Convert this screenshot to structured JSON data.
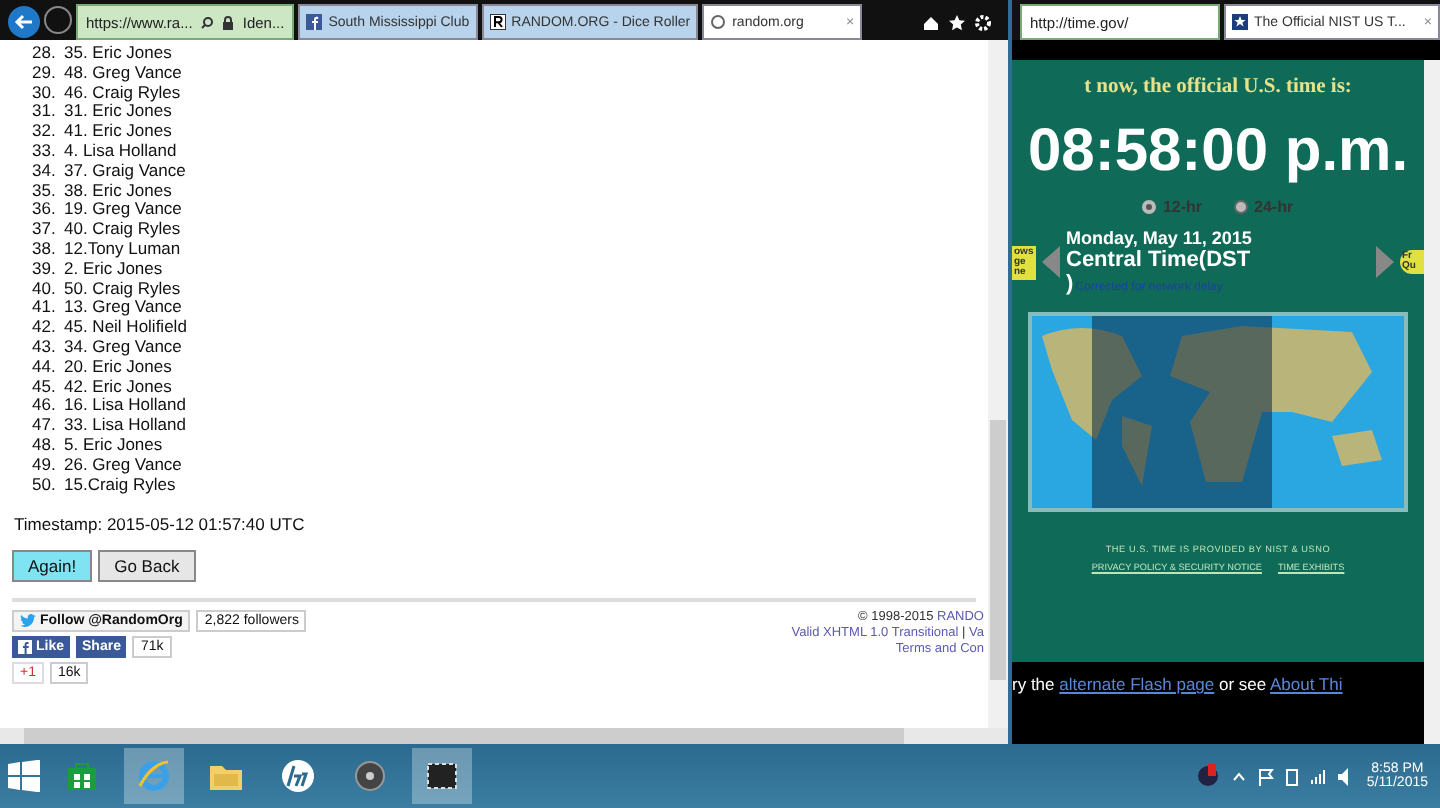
{
  "left_browser": {
    "address": "https://www.ra...",
    "identity": "Iden...",
    "tabs": [
      {
        "kind": "facebook",
        "label": "South Mississippi Club",
        "selected": false
      },
      {
        "kind": "random",
        "label": "RANDOM.ORG - Dice Roller",
        "selected": false
      },
      {
        "kind": "loading",
        "label": "random.org",
        "selected": true,
        "close": "×"
      }
    ],
    "results": [
      {
        "index": "28.",
        "value": "35. Eric Jones"
      },
      {
        "index": "29.",
        "value": "48. Greg Vance"
      },
      {
        "index": "30.",
        "value": "46. Craig Ryles"
      },
      {
        "index": "31.",
        "value": "31. Eric Jones"
      },
      {
        "index": "32.",
        "value": "41. Eric Jones"
      },
      {
        "index": "33.",
        "value": "4. Lisa Holland"
      },
      {
        "index": "34.",
        "value": "37. Graig Vance"
      },
      {
        "index": "35.",
        "value": "38. Eric Jones"
      },
      {
        "index": "36.",
        "value": "19. Greg Vance"
      },
      {
        "index": "37.",
        "value": "40. Craig Ryles"
      },
      {
        "index": "38.",
        "value": "12.Tony Luman"
      },
      {
        "index": "39.",
        "value": "2. Eric Jones"
      },
      {
        "index": "40.",
        "value": "50. Craig Ryles"
      },
      {
        "index": "41.",
        "value": "13. Greg Vance"
      },
      {
        "index": "42.",
        "value": "45. Neil Holifield"
      },
      {
        "index": "43.",
        "value": "34. Greg Vance"
      },
      {
        "index": "44.",
        "value": "20. Eric Jones"
      },
      {
        "index": "45.",
        "value": "42. Eric Jones"
      },
      {
        "index": "46.",
        "value": "16. Lisa Holland"
      },
      {
        "index": "47.",
        "value": "33. Lisa Holland"
      },
      {
        "index": "48.",
        "value": "5. Eric Jones"
      },
      {
        "index": "49.",
        "value": "26. Greg Vance"
      },
      {
        "index": "50.",
        "value": "15.Craig Ryles"
      }
    ],
    "timestamp": "Timestamp: 2015-05-12 01:57:40 UTC",
    "buttons": [
      {
        "label": "Again!",
        "selected": true
      },
      {
        "label": "Go Back",
        "selected": false
      }
    ],
    "social": {
      "follow": "Follow @RandomOrg",
      "followers": "2,822 followers",
      "like": "Like",
      "share": "Share",
      "share_count": "71k",
      "plus": "+1",
      "plus_count": "16k"
    },
    "footer": {
      "copyright": "© 1998-2015",
      "copyright_link": "RANDO",
      "xhtml": "Valid XHTML 1.0 Transitional",
      "separator": "|",
      "va": "Va",
      "terms": "Terms and Con"
    }
  },
  "right_browser": {
    "address": "http://time.gov/",
    "tab": "The Official NIST US T...",
    "tab_close": "×",
    "heading": "t now, the official U.S. time is:",
    "time": "08:58:00 p.m.",
    "formats": [
      {
        "label": "12-hr",
        "selected": true
      },
      {
        "label": "24-hr",
        "selected": false
      }
    ],
    "left_badge": "ows ge ne",
    "right_badge": "Fr Qu",
    "date": "Monday, May 11, 2015",
    "zone": "Central Time(DST",
    "zone_end": ")",
    "note": "Corrected for network delay",
    "provided": "THE U.S. TIME IS PROVIDED BY NIST & USNO",
    "privacy": "PRIVACY POLICY & SECURITY NOTICE",
    "exhibits": "TIME EXHIBITS",
    "band": [
      {
        "kind": "text",
        "text": "ry the "
      },
      {
        "kind": "link",
        "text": "alternate Flash page"
      },
      {
        "kind": "text",
        "text": " or see "
      },
      {
        "kind": "link",
        "text": "About Thi"
      }
    ]
  },
  "taskbar": {
    "apps": [
      {
        "kind": "store",
        "selected": false
      },
      {
        "kind": "browser",
        "selected": true
      },
      {
        "kind": "folder",
        "selected": false
      },
      {
        "kind": "hp",
        "selected": false
      },
      {
        "kind": "disc",
        "selected": false
      },
      {
        "kind": "capture",
        "selected": true
      }
    ],
    "time": "8:58 PM",
    "date": "5/11/2015"
  }
}
